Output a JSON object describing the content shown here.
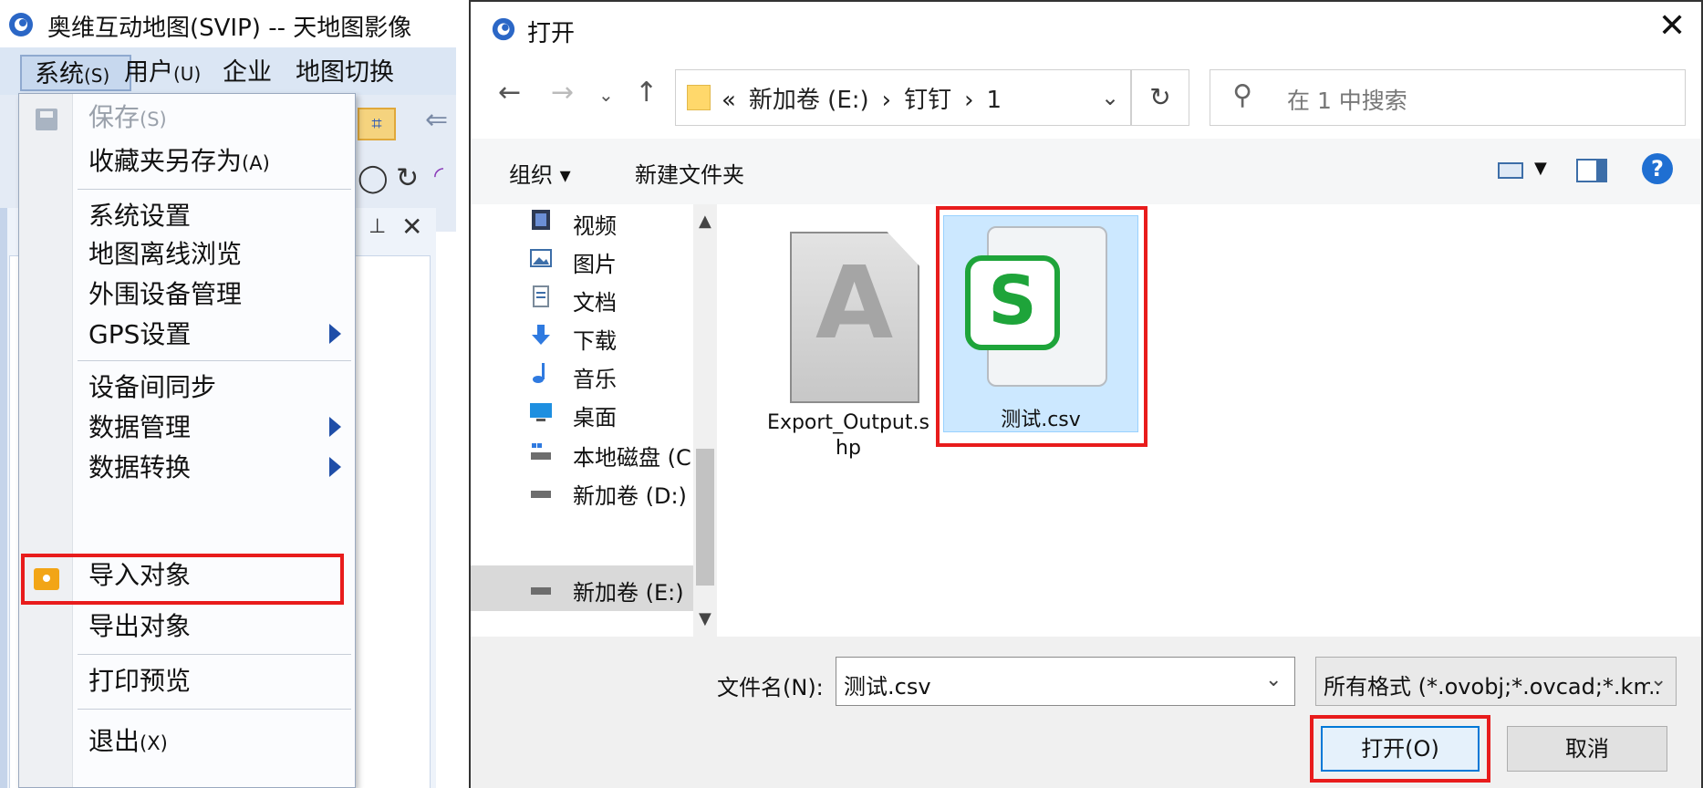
{
  "app": {
    "title": "奥维互动地图(SVIP) -- 天地图影像",
    "menubar": [
      {
        "label": "系统",
        "accel": "(S)"
      },
      {
        "label": "用户",
        "accel": "(U)"
      },
      {
        "label": "企业",
        "accel": ""
      },
      {
        "label": "地图切换",
        "accel": ""
      }
    ],
    "menu": {
      "save": {
        "label": "保存",
        "accel": "(S)"
      },
      "save_as": {
        "label": "收藏夹另存为",
        "accel": "(A)"
      },
      "settings": "系统设置",
      "offline": "地图离线浏览",
      "peripheral": "外围设备管理",
      "gps": "GPS设置",
      "sync": "设备间同步",
      "data_mgmt": "数据管理",
      "data_convert": "数据转换",
      "import": "导入对象",
      "export": "导出对象",
      "print": "打印预览",
      "exit": {
        "label": "退出",
        "accel": "(X)"
      }
    }
  },
  "dialog": {
    "title": "打开",
    "breadcrumb": [
      "«",
      "新加卷 (E:)",
      "›",
      "钉钉",
      "›",
      "1"
    ],
    "search_placeholder": "在 1 中搜索",
    "organize": "组织 ▾",
    "new_folder": "新建文件夹",
    "nav_items": [
      {
        "label": "视频",
        "icon": "video-icon"
      },
      {
        "label": "图片",
        "icon": "picture-icon"
      },
      {
        "label": "文档",
        "icon": "document-icon"
      },
      {
        "label": "下载",
        "icon": "download-icon"
      },
      {
        "label": "音乐",
        "icon": "music-icon"
      },
      {
        "label": "桌面",
        "icon": "desktop-icon"
      },
      {
        "label": "本地磁盘 (C:)",
        "icon": "drive-icon"
      },
      {
        "label": "新加卷 (D:)",
        "icon": "drive-icon"
      },
      {
        "label": "新加卷 (E:)",
        "icon": "drive-icon"
      }
    ],
    "files": [
      {
        "name": "Export_Output.shp",
        "line1": "Export_Output.s",
        "line2": "hp"
      },
      {
        "name": "测试.csv"
      }
    ],
    "filename_label": "文件名(N):",
    "filename_value": "测试.csv",
    "filetype_value": "所有格式 (*.ovobj;*.ovcad;*.kml",
    "open_button": "打开(O)",
    "cancel_button": "取消"
  },
  "colors": {
    "highlight_red": "#e81c1c",
    "accent_blue": "#0078d7",
    "selected_file_bg": "#cce8ff",
    "csv_green": "#1ea43a"
  }
}
